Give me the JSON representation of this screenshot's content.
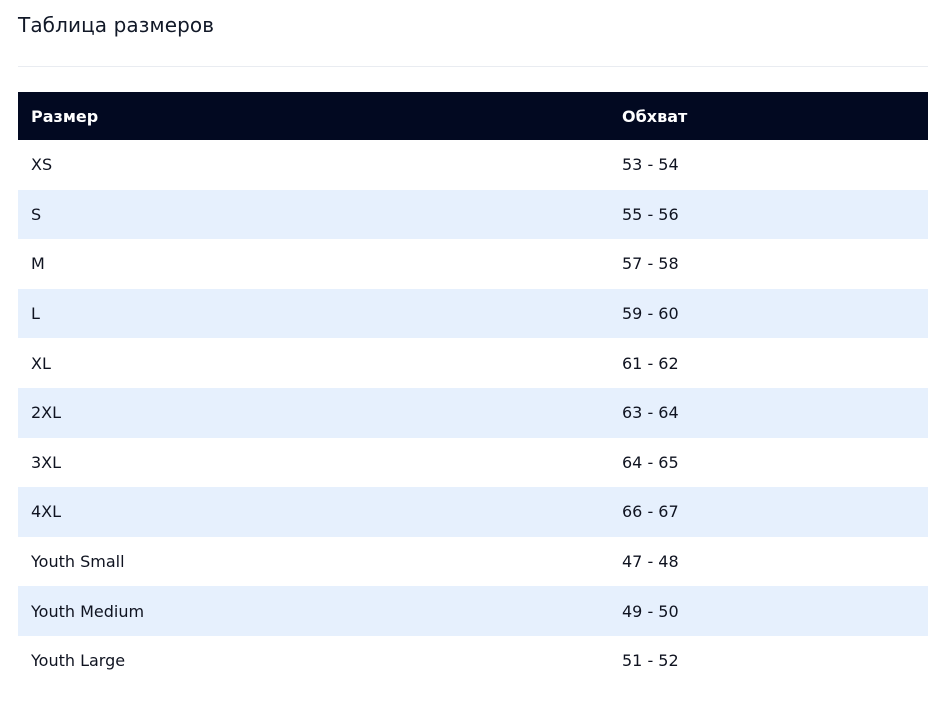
{
  "page": {
    "title": "Таблица размеров"
  },
  "table": {
    "headers": {
      "size": "Размер",
      "girth": "Обхват"
    },
    "rows": [
      {
        "size": "XS",
        "girth": "53 - 54"
      },
      {
        "size": "S",
        "girth": "55 - 56"
      },
      {
        "size": "M",
        "girth": "57 - 58"
      },
      {
        "size": "L",
        "girth": "59 - 60"
      },
      {
        "size": "XL",
        "girth": "61 - 62"
      },
      {
        "size": "2XL",
        "girth": "63 - 64"
      },
      {
        "size": "3XL",
        "girth": "64 - 65"
      },
      {
        "size": "4XL",
        "girth": "66 - 67"
      },
      {
        "size": "Youth Small",
        "girth": "47 - 48"
      },
      {
        "size": "Youth Medium",
        "girth": "49 - 50"
      },
      {
        "size": "Youth Large",
        "girth": "51 - 52"
      }
    ]
  },
  "colors": {
    "header_bg": "#020921",
    "header_text": "#ffffff",
    "stripe_bg": "#e6f0fd",
    "text": "#0f1320"
  }
}
